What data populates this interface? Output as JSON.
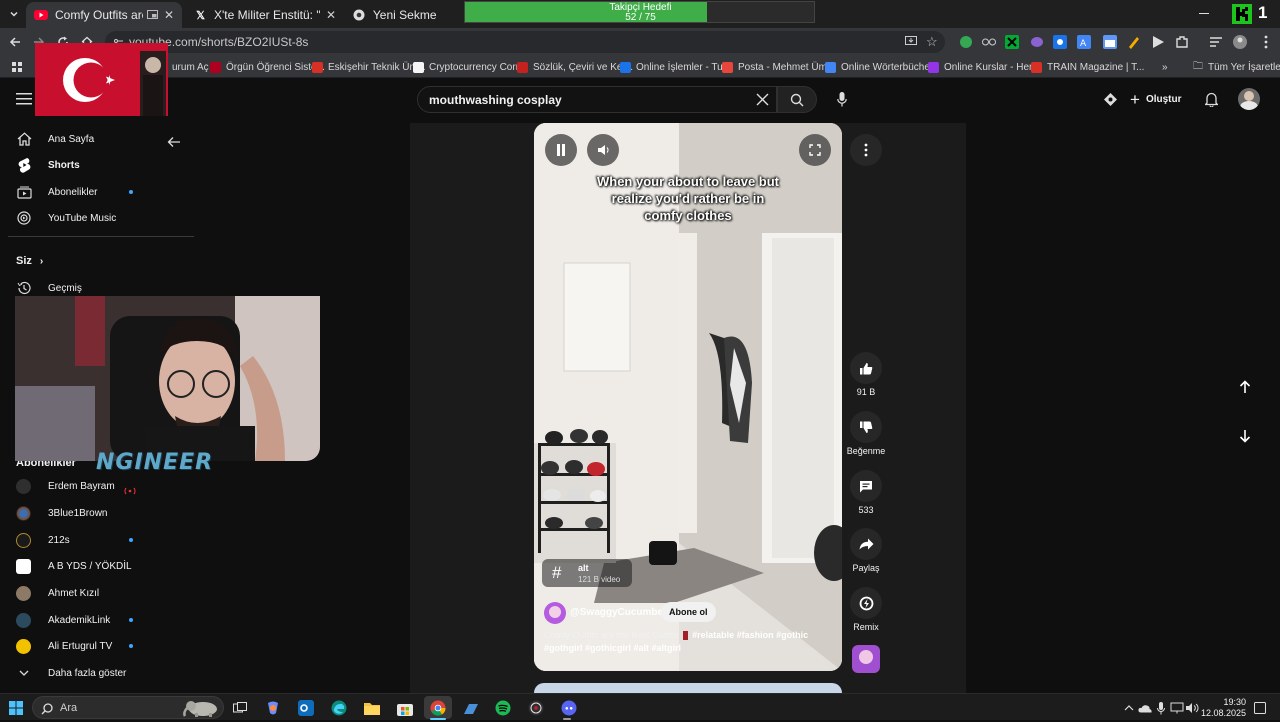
{
  "browser": {
    "tabs": [
      {
        "title": "Comfy Outfits are the Best",
        "active": true
      },
      {
        "title": "X'te Militer Enstitü: \"Ekrem İmam",
        "active": false
      },
      {
        "title": "Yeni Sekme",
        "active": false
      }
    ],
    "url": "youtube.com/shorts/BZO2IUSt-8s",
    "bookmarks": [
      "urum Aç",
      "Örgün Öğrenci Siste...",
      "Eskişehir Teknik Üni...",
      "Cryptocurrency Corr...",
      "Sözlük, Çeviri ve Kel...",
      "Online İşlemler - Tu...",
      "Posta - Mehmet Üm...",
      "Online Wörterbüche...",
      "Online Kurslar - Her...",
      "TRAIN Magazine | T..."
    ],
    "bookmarks_all": "Tüm Yer İşaretleri",
    "extension_badge": "1"
  },
  "follower_goal": {
    "title": "Takipçi Hedefi",
    "count_text": "52 / 75",
    "current": 52,
    "target": 75
  },
  "youtube": {
    "search_query": "mouthwashing cosplay",
    "create_label": "Oluştur",
    "sidebar": {
      "nav": [
        {
          "label": "Ana Sayfa",
          "icon": "home-icon"
        },
        {
          "label": "Shorts",
          "icon": "shorts-icon"
        },
        {
          "label": "Abonelikler",
          "icon": "subscriptions-icon"
        },
        {
          "label": "YouTube Music",
          "icon": "music-icon"
        }
      ],
      "you_heading": "Siz",
      "history_label": "Geçmiş",
      "subscriptions_heading": "Abonelikler",
      "subscriptions": [
        {
          "name": "Erdem Bayram",
          "live": true
        },
        {
          "name": "3Blue1Brown",
          "live": false
        },
        {
          "name": "212s",
          "live": false
        },
        {
          "name": "A B YDS / YÖKDİL",
          "live": false
        },
        {
          "name": "Ahmet Kızıl",
          "live": false
        },
        {
          "name": "AkademikLink",
          "live": false
        },
        {
          "name": "Ali Ertugrul TV",
          "live": false
        }
      ],
      "show_more": "Daha fazla göster"
    },
    "short": {
      "caption": "When your about to leave but realize you'd rather be in comfy clothes",
      "hashtag": "alt",
      "hashtag_count": "121 B video",
      "channel": "@SwaggyCucumber",
      "subscribe_label": "Abone ol",
      "description_text": "Comfy Outfits are the Best Outfits",
      "description_tags": "#relatable #fashion #gothic #gothgirl #gothicgirl #alt #altgirl",
      "likes": "91 B",
      "dislike_label": "Beğenme",
      "comments": "533",
      "share_label": "Paylaş",
      "remix_label": "Remix"
    }
  },
  "stream": {
    "streamer_name": "NGINEER"
  },
  "taskbar": {
    "search_placeholder": "Ara",
    "time": "19:30",
    "date": "12.08.2025"
  }
}
